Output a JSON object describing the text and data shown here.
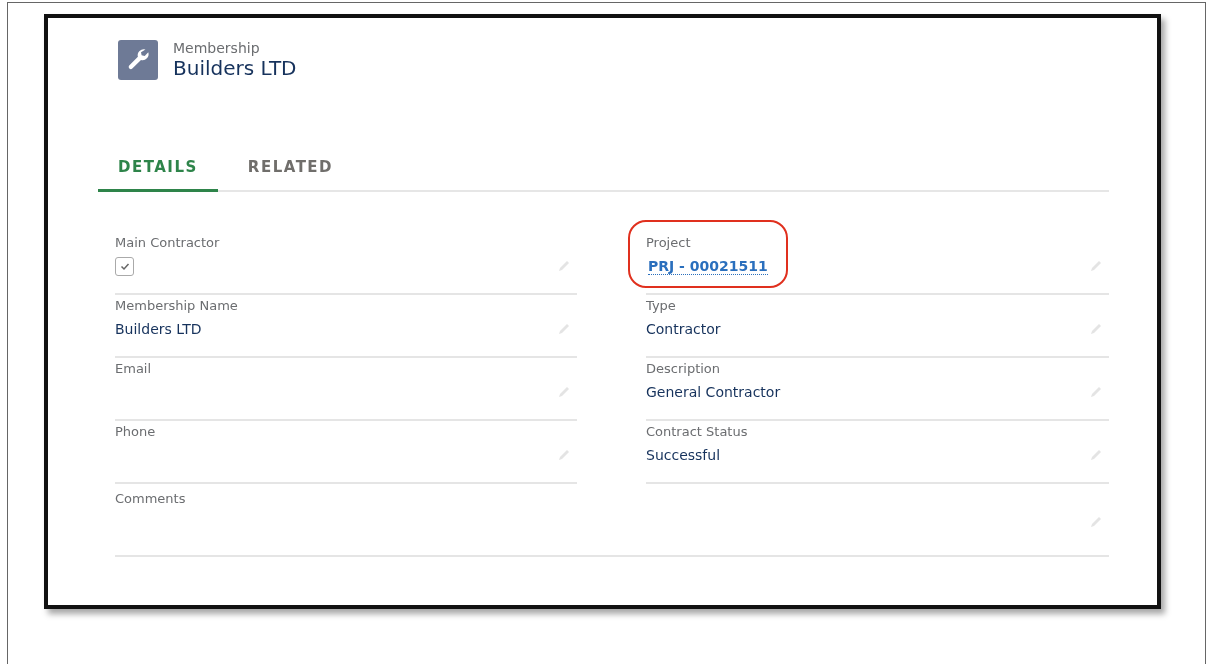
{
  "header": {
    "object_type": "Membership",
    "title": "Builders LTD"
  },
  "tabs": [
    {
      "label": "DETAILS",
      "selected": true
    },
    {
      "label": "RELATED",
      "selected": false
    }
  ],
  "left_fields": [
    {
      "label": "Main Contractor",
      "kind": "checkbox",
      "checked": true,
      "highlighted": false
    },
    {
      "label": "Membership Name",
      "kind": "text",
      "value": "Builders LTD",
      "highlighted": false
    },
    {
      "label": "Email",
      "highlighted": false
    },
    {
      "label": "Phone",
      "highlighted": false
    }
  ],
  "right_fields": [
    {
      "label": "Project",
      "kind": "link",
      "value": "PRJ - 00021511",
      "highlighted": true
    },
    {
      "label": "Type",
      "kind": "text",
      "value": "Contractor",
      "highlighted": false
    },
    {
      "label": "Description",
      "kind": "text",
      "value": "General Contractor",
      "highlighted": false
    },
    {
      "label": "Contract Status",
      "kind": "text",
      "value": "Successful",
      "highlighted": false
    }
  ],
  "wide_fields": [
    {
      "label": "Comments",
      "highlighted": false
    }
  ]
}
